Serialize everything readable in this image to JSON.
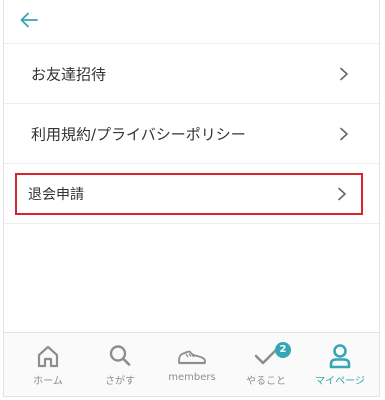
{
  "header": {
    "back_icon": "back-arrow-icon"
  },
  "menu": {
    "items": [
      {
        "label": "お友達招待",
        "icon": "chevron-right-icon"
      },
      {
        "label": "利用規約/プライバシーポリシー",
        "icon": "chevron-right-icon"
      },
      {
        "label": "退会申請",
        "icon": "chevron-right-icon",
        "highlighted": true
      }
    ]
  },
  "tabbar": {
    "tabs": [
      {
        "label": "ホーム",
        "icon": "home-icon",
        "active": false
      },
      {
        "label": "さがす",
        "icon": "search-icon",
        "active": false
      },
      {
        "label": "members",
        "icon": "shoe-icon",
        "active": false
      },
      {
        "label": "やること",
        "icon": "check-icon",
        "active": false,
        "badge": "2"
      },
      {
        "label": "マイページ",
        "icon": "user-icon",
        "active": true
      }
    ]
  },
  "colors": {
    "accent": "#35a6b3",
    "highlight_border": "#d9262c",
    "inactive_tab": "#8e8e8e",
    "text": "#333333"
  }
}
